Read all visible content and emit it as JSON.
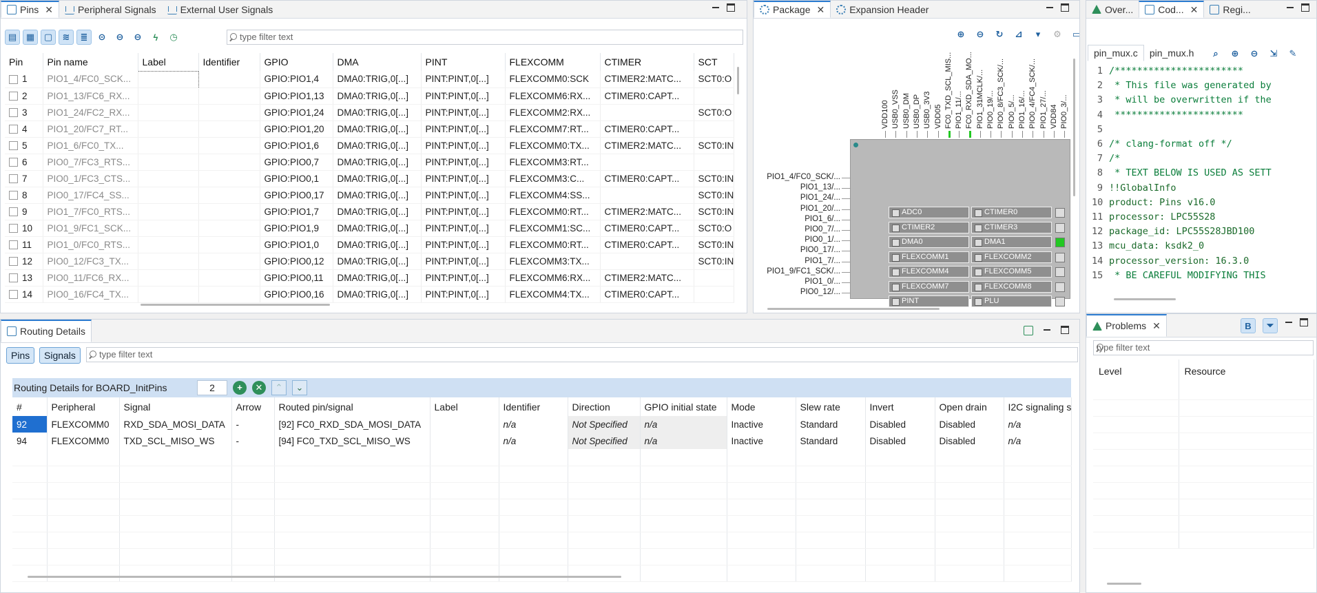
{
  "pins_panel": {
    "tabs": [
      {
        "label": "Pins"
      },
      {
        "label": "Peripheral Signals"
      },
      {
        "label": "External User Signals"
      }
    ],
    "filter_placeholder": "type filter text",
    "columns": [
      "Pin",
      "Pin name",
      "Label",
      "Identifier",
      "GPIO",
      "DMA",
      "PINT",
      "FLEXCOMM",
      "CTIMER",
      "SCT"
    ],
    "rows": [
      {
        "pin": "1",
        "name": "PIO1_4/FC0_SCK...",
        "gpio": "GPIO:PIO1,4",
        "dma": "DMA0:TRIG,0[...]",
        "pint": "PINT:PINT,0[...]",
        "flexcomm": "FLEXCOMM0:SCK",
        "ctimer": "CTIMER2:MATC...",
        "sct": "SCT0:O"
      },
      {
        "pin": "2",
        "name": "PIO1_13/FC6_RX...",
        "gpio": "GPIO:PIO1,13",
        "dma": "DMA0:TRIG,0[...]",
        "pint": "PINT:PINT,0[...]",
        "flexcomm": "FLEXCOMM6:RX...",
        "ctimer": "CTIMER0:CAPT...",
        "sct": ""
      },
      {
        "pin": "3",
        "name": "PIO1_24/FC2_RX...",
        "gpio": "GPIO:PIO1,24",
        "dma": "DMA0:TRIG,0[...]",
        "pint": "PINT:PINT,0[...]",
        "flexcomm": "FLEXCOMM2:RX...",
        "ctimer": "",
        "sct": "SCT0:O"
      },
      {
        "pin": "4",
        "name": "PIO1_20/FC7_RT...",
        "gpio": "GPIO:PIO1,20",
        "dma": "DMA0:TRIG,0[...]",
        "pint": "PINT:PINT,0[...]",
        "flexcomm": "FLEXCOMM7:RT...",
        "ctimer": "CTIMER0:CAPT...",
        "sct": ""
      },
      {
        "pin": "5",
        "name": "PIO1_6/FC0_TX...",
        "gpio": "GPIO:PIO1,6",
        "dma": "DMA0:TRIG,0[...]",
        "pint": "PINT:PINT,0[...]",
        "flexcomm": "FLEXCOMM0:TX...",
        "ctimer": "CTIMER2:MATC...",
        "sct": "SCT0:IN"
      },
      {
        "pin": "6",
        "name": "PIO0_7/FC3_RTS...",
        "gpio": "GPIO:PIO0,7",
        "dma": "DMA0:TRIG,0[...]",
        "pint": "PINT:PINT,0[...]",
        "flexcomm": "FLEXCOMM3:RT...",
        "ctimer": "",
        "sct": ""
      },
      {
        "pin": "7",
        "name": "PIO0_1/FC3_CTS...",
        "gpio": "GPIO:PIO0,1",
        "dma": "DMA0:TRIG,0[...]",
        "pint": "PINT:PINT,0[...]",
        "flexcomm": "FLEXCOMM3:C...",
        "ctimer": "CTIMER0:CAPT...",
        "sct": "SCT0:IN"
      },
      {
        "pin": "8",
        "name": "PIO0_17/FC4_SS...",
        "gpio": "GPIO:PIO0,17",
        "dma": "DMA0:TRIG,0[...]",
        "pint": "PINT:PINT,0[...]",
        "flexcomm": "FLEXCOMM4:SS...",
        "ctimer": "",
        "sct": "SCT0:IN"
      },
      {
        "pin": "9",
        "name": "PIO1_7/FC0_RTS...",
        "gpio": "GPIO:PIO1,7",
        "dma": "DMA0:TRIG,0[...]",
        "pint": "PINT:PINT,0[...]",
        "flexcomm": "FLEXCOMM0:RT...",
        "ctimer": "CTIMER2:MATC...",
        "sct": "SCT0:IN"
      },
      {
        "pin": "10",
        "name": "PIO1_9/FC1_SCK...",
        "gpio": "GPIO:PIO1,9",
        "dma": "DMA0:TRIG,0[...]",
        "pint": "PINT:PINT,0[...]",
        "flexcomm": "FLEXCOMM1:SC...",
        "ctimer": "CTIMER0:CAPT...",
        "sct": "SCT0:O"
      },
      {
        "pin": "11",
        "name": "PIO1_0/FC0_RTS...",
        "gpio": "GPIO:PIO1,0",
        "dma": "DMA0:TRIG,0[...]",
        "pint": "PINT:PINT,0[...]",
        "flexcomm": "FLEXCOMM0:RT...",
        "ctimer": "CTIMER0:CAPT...",
        "sct": "SCT0:IN"
      },
      {
        "pin": "12",
        "name": "PIO0_12/FC3_TX...",
        "gpio": "GPIO:PIO0,12",
        "dma": "DMA0:TRIG,0[...]",
        "pint": "PINT:PINT,0[...]",
        "flexcomm": "FLEXCOMM3:TX...",
        "ctimer": "",
        "sct": "SCT0:IN"
      },
      {
        "pin": "13",
        "name": "PIO0_11/FC6_RX...",
        "gpio": "GPIO:PIO0,11",
        "dma": "DMA0:TRIG,0[...]",
        "pint": "PINT:PINT,0[...]",
        "flexcomm": "FLEXCOMM6:RX...",
        "ctimer": "CTIMER2:MATC...",
        "sct": ""
      },
      {
        "pin": "14",
        "name": "PIO0_16/FC4_TX...",
        "gpio": "GPIO:PIO0,16",
        "dma": "DMA0:TRIG,0[...]",
        "pint": "PINT:PINT,0[...]",
        "flexcomm": "FLEXCOMM4:TX...",
        "ctimer": "CTIMER0:CAPT...",
        "sct": ""
      }
    ]
  },
  "package_panel": {
    "tabs": [
      {
        "label": "Package"
      },
      {
        "label": "Expansion Header"
      }
    ],
    "left_pins": [
      "PIO1_4/FC0_SCK/...",
      "PIO1_13/...",
      "PIO1_24/...",
      "PIO1_20/...",
      "PIO1_6/...",
      "PIO0_7/...",
      "PIO0_1/...",
      "PIO0_17/...",
      "PIO1_7/...",
      "PIO1_9/FC1_SCK/...",
      "PIO1_0/...",
      "PIO0_12/..."
    ],
    "top_pins": [
      "VDD100",
      "USB0_VSS",
      "USB0_DM",
      "USB0_DP",
      "USB0_3V3",
      "VDD05",
      "FC0_TXD_SCL_MIS...",
      "PIO1_11/...",
      "FC0_RXD_SDA_MO...",
      "PIO1_31MCLK/...",
      "PIO0_19/...",
      "PIO0_8/FC3_SCK/...",
      "PIO0_5/...",
      "PIO1_16/...",
      "PIO0_4/FC4_SCK/...",
      "PIO1_27/...",
      "VDD84",
      "PIO0_3/..."
    ],
    "peripherals": [
      {
        "label": "ADC0",
        "on": false
      },
      {
        "label": "CTIMER0",
        "on": false
      },
      {
        "label": "CTIMER2",
        "on": false
      },
      {
        "label": "CTIMER3",
        "on": false
      },
      {
        "label": "DMA0",
        "on": false
      },
      {
        "label": "DMA1",
        "on": false
      },
      {
        "label": "FLEXCOMM1",
        "on": false
      },
      {
        "label": "FLEXCOMM2",
        "on": false
      },
      {
        "label": "FLEXCOMM4",
        "on": false
      },
      {
        "label": "FLEXCOMM5",
        "on": false
      },
      {
        "label": "FLEXCOMM7",
        "on": false
      },
      {
        "label": "FLEXCOMM8",
        "on": false
      },
      {
        "label": "PINT",
        "on": false
      },
      {
        "label": "PLU",
        "on": false
      }
    ]
  },
  "code_panel": {
    "tabs": [
      {
        "label": "Over..."
      },
      {
        "label": "Cod..."
      },
      {
        "label": "Regi..."
      }
    ],
    "file_tabs": [
      {
        "label": "pin_mux.c"
      },
      {
        "label": "pin_mux.h"
      }
    ],
    "lines": [
      {
        "n": "1",
        "text": "/***********************"
      },
      {
        "n": "2",
        "text": " * This file was generated by"
      },
      {
        "n": "3",
        "text": " * will be overwritten if the"
      },
      {
        "n": "4",
        "text": " ***********************"
      },
      {
        "n": "5",
        "text": ""
      },
      {
        "n": "6",
        "text": "/* clang-format off */"
      },
      {
        "n": "7",
        "text": "/*"
      },
      {
        "n": "8",
        "text": " * TEXT BELOW IS USED AS SETT"
      },
      {
        "n": "9",
        "text": "!!GlobalInfo"
      },
      {
        "n": "10",
        "text": "product: Pins v16.0"
      },
      {
        "n": "11",
        "text": "processor: LPC55S28"
      },
      {
        "n": "12",
        "text": "package_id: LPC55S28JBD100"
      },
      {
        "n": "13",
        "text": "mcu_data: ksdk2_0"
      },
      {
        "n": "14",
        "text": "processor_version: 16.3.0"
      },
      {
        "n": "15",
        "text": " * BE CAREFUL MODIFYING THIS"
      }
    ]
  },
  "routing_panel": {
    "tab_label": "Routing Details",
    "toggle_pins": "Pins",
    "toggle_signals": "Signals",
    "filter_placeholder": "type filter text",
    "header_title": "Routing Details for BOARD_InitPins",
    "count": "2",
    "columns": [
      "#",
      "Peripheral",
      "Signal",
      "Arrow",
      "Routed pin/signal",
      "Label",
      "Identifier",
      "Direction",
      "GPIO initial state",
      "Mode",
      "Slew rate",
      "Invert",
      "Open drain",
      "I2C signaling s"
    ],
    "rows": [
      {
        "num": "92",
        "peripheral": "FLEXCOMM0",
        "signal": "RXD_SDA_MOSI_DATA",
        "arrow": "-",
        "routed": "[92] FC0_RXD_SDA_MOSI_DATA",
        "label": "",
        "identifier": "n/a",
        "direction": "Not Specified",
        "gpio_init": "n/a",
        "mode": "Inactive",
        "slew": "Standard",
        "invert": "Disabled",
        "open_drain": "Disabled",
        "i2c": "n/a"
      },
      {
        "num": "94",
        "peripheral": "FLEXCOMM0",
        "signal": "TXD_SCL_MISO_WS",
        "arrow": "-",
        "routed": "[94] FC0_TXD_SCL_MISO_WS",
        "label": "",
        "identifier": "n/a",
        "direction": "Not Specified",
        "gpio_init": "n/a",
        "mode": "Inactive",
        "slew": "Standard",
        "invert": "Disabled",
        "open_drain": "Disabled",
        "i2c": "n/a"
      }
    ]
  },
  "problems_panel": {
    "tab_label": "Problems",
    "filter_placeholder": "type filter text",
    "columns": [
      "Level",
      "Resource"
    ]
  }
}
